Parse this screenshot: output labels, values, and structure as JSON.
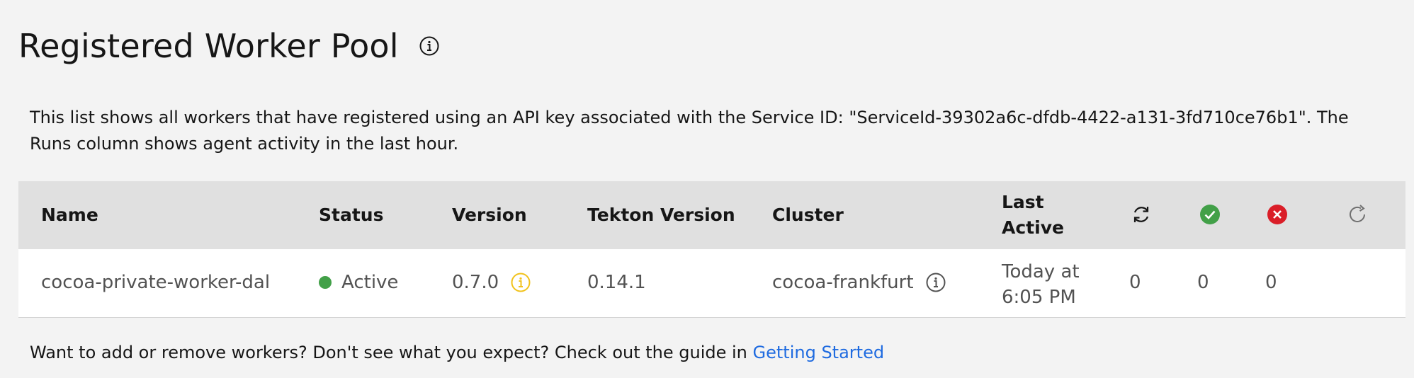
{
  "header": {
    "title": "Registered Worker Pool"
  },
  "description": "This list shows all workers that have registered using an API key associated with the Service ID: \"ServiceId-39302a6c-dfdb-4422-a131-3fd710ce76b1\". The Runs column shows agent activity in the last hour.",
  "table": {
    "columns": {
      "name": "Name",
      "status": "Status",
      "version": "Version",
      "tekton_version": "Tekton Version",
      "cluster": "Cluster",
      "last_active": "Last Active"
    },
    "rows": [
      {
        "name": "cocoa-private-worker-dal",
        "status": "Active",
        "version": "0.7.0",
        "tekton_version": "0.14.1",
        "cluster": "cocoa-frankfurt",
        "last_active": "Today at 6:05 PM",
        "runs": "0",
        "succeeded": "0",
        "failed": "0"
      }
    ]
  },
  "footer": {
    "text": "Want to add or remove workers? Don't see what you expect? Check out the guide in ",
    "link_label": "Getting Started"
  },
  "colors": {
    "active_status": "#42a048",
    "success_icon": "#42a048",
    "fail_icon": "#da1e28",
    "version_warning": "#f1c21b",
    "link": "#1f6be0"
  },
  "icons": {
    "title_info": "info-icon",
    "runs_header": "sync-icon",
    "success_header": "checkmark-filled-icon",
    "fail_header": "error-filled-icon",
    "refresh_header": "refresh-icon",
    "version_info": "warning-info-icon",
    "cluster_info": "info-icon"
  }
}
